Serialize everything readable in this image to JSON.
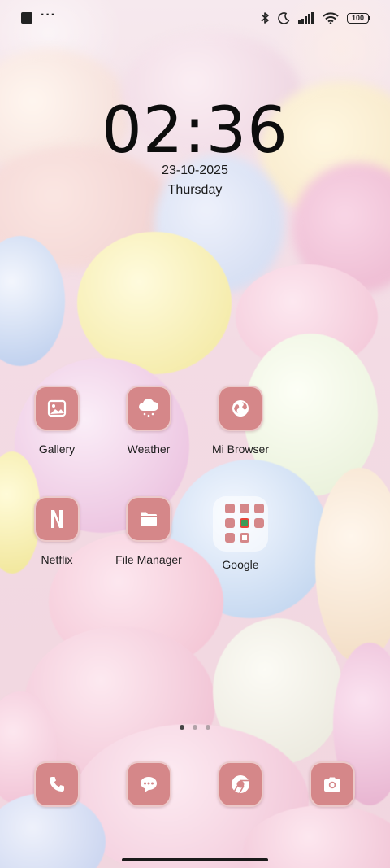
{
  "status_bar": {
    "notification_icons": [
      "square-notification-icon",
      "more-dots-icon"
    ],
    "right_icons": [
      "bluetooth-icon",
      "moon-icon",
      "signal-icon",
      "wifi-icon"
    ],
    "battery_level": "100"
  },
  "lockscreen": {
    "time": "02:36",
    "date": "23-10-2025",
    "weekday": "Thursday"
  },
  "apps": [
    {
      "label": "Gallery",
      "icon": "gallery-icon"
    },
    {
      "label": "Weather",
      "icon": "weather-cloud-icon"
    },
    {
      "label": "Mi Browser",
      "icon": "globe-icon"
    },
    {
      "label": "Netflix",
      "icon": "netflix-icon"
    },
    {
      "label": "File Manager",
      "icon": "folder-icon"
    },
    {
      "label": "Google",
      "icon": "google-folder-icon"
    }
  ],
  "page_indicator": {
    "pages": 3,
    "active": 1
  },
  "dock": [
    {
      "icon": "phone-icon"
    },
    {
      "icon": "messages-icon"
    },
    {
      "icon": "chrome-icon"
    },
    {
      "icon": "camera-icon"
    }
  ],
  "colors": {
    "icon_tile": "#d58789",
    "text": "#1c1c1c",
    "wallpaper": "#f3dbe4"
  }
}
